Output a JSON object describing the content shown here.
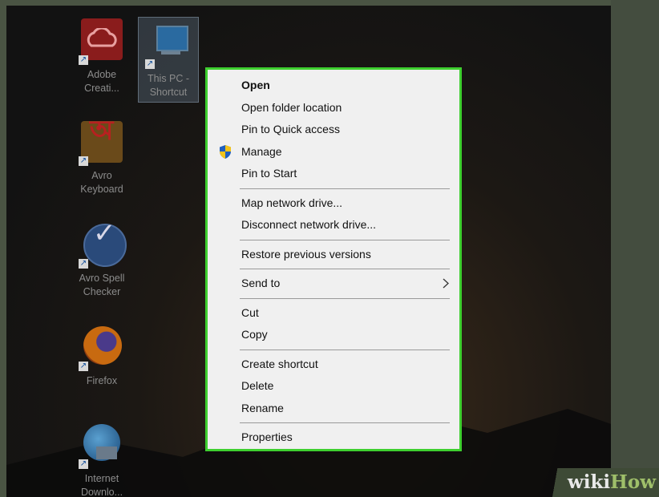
{
  "desktop_icons": [
    {
      "label": "Adobe\nCreati...",
      "icon": "adobe-creative-cloud-icon"
    },
    {
      "label": "This PC -\nShortcut",
      "icon": "this-pc-icon"
    },
    {
      "label": "Avro\nKeyboard",
      "icon": "avro-keyboard-icon"
    },
    {
      "label": "Avro Spell\nChecker",
      "icon": "avro-spell-checker-icon"
    },
    {
      "label": "Firefox",
      "icon": "firefox-icon"
    },
    {
      "label": "Internet\nDownlo...",
      "icon": "internet-download-icon"
    }
  ],
  "context_menu": {
    "items": [
      {
        "label": "Open"
      },
      {
        "label": "Open folder location"
      },
      {
        "label": "Pin to Quick access"
      },
      {
        "label": "Manage",
        "icon": "uac-shield-icon"
      },
      {
        "label": "Pin to Start"
      },
      {
        "label": "Map network drive..."
      },
      {
        "label": "Disconnect network drive..."
      },
      {
        "label": "Restore previous versions"
      },
      {
        "label": "Send to",
        "icon": "chevron-right-icon"
      },
      {
        "label": "Cut"
      },
      {
        "label": "Copy"
      },
      {
        "label": "Create shortcut"
      },
      {
        "label": "Delete"
      },
      {
        "label": "Rename"
      },
      {
        "label": "Properties"
      }
    ]
  },
  "watermark": {
    "wiki": "wiki",
    "how": "How"
  },
  "colors": {
    "highlight_border": "#3ecf2f"
  }
}
